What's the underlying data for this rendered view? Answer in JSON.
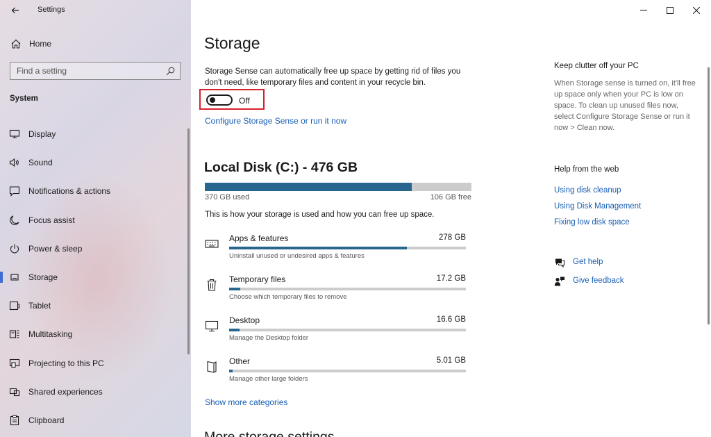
{
  "window": {
    "title": "Settings",
    "controls": {
      "minimize": "minimize",
      "maximize": "maximize",
      "close": "close"
    }
  },
  "sidebar": {
    "home_label": "Home",
    "search_placeholder": "Find a setting",
    "section_label": "System",
    "items": [
      {
        "label": "Display",
        "icon": "display-icon"
      },
      {
        "label": "Sound",
        "icon": "sound-icon"
      },
      {
        "label": "Notifications & actions",
        "icon": "notifications-icon"
      },
      {
        "label": "Focus assist",
        "icon": "moon-icon"
      },
      {
        "label": "Power & sleep",
        "icon": "power-icon"
      },
      {
        "label": "Storage",
        "icon": "storage-icon",
        "selected": true
      },
      {
        "label": "Tablet",
        "icon": "tablet-icon"
      },
      {
        "label": "Multitasking",
        "icon": "multitasking-icon"
      },
      {
        "label": "Projecting to this PC",
        "icon": "projecting-icon"
      },
      {
        "label": "Shared experiences",
        "icon": "shared-icon"
      },
      {
        "label": "Clipboard",
        "icon": "clipboard-icon"
      }
    ]
  },
  "main": {
    "title": "Storage",
    "storage_sense": {
      "description": "Storage Sense can automatically free up space by getting rid of files you don't need, like temporary files and content in your recycle bin.",
      "toggle_state": "Off",
      "toggle_on": false,
      "configure_link": "Configure Storage Sense or run it now"
    },
    "disk": {
      "title": "Local Disk (C:) - 476 GB",
      "used_label": "370 GB used",
      "free_label": "106 GB free",
      "used_fraction": 0.777,
      "description": "This is how your storage is used and how you can free up space."
    },
    "categories": [
      {
        "name": "Apps & features",
        "size": "278 GB",
        "subtitle": "Uninstall unused or undesired apps & features",
        "fraction": 0.751,
        "icon": "keyboard-icon"
      },
      {
        "name": "Temporary files",
        "size": "17.2 GB",
        "subtitle": "Choose which temporary files to remove",
        "fraction": 0.046,
        "icon": "trash-icon"
      },
      {
        "name": "Desktop",
        "size": "16.6 GB",
        "subtitle": "Manage the Desktop folder",
        "fraction": 0.045,
        "icon": "monitor-icon"
      },
      {
        "name": "Other",
        "size": "5.01 GB",
        "subtitle": "Manage other large folders",
        "fraction": 0.014,
        "icon": "book-icon"
      }
    ],
    "show_more": "Show more categories",
    "next_heading_partial": "More storage settings"
  },
  "right": {
    "clutter_heading": "Keep clutter off your PC",
    "clutter_text": "When Storage sense is turned on, it'll free up space only when your PC is low on space. To clean up unused files now, select Configure Storage Sense or run it now > Clean now.",
    "web_heading": "Help from the web",
    "web_links": [
      "Using disk cleanup",
      "Using Disk Management",
      "Fixing low disk space"
    ],
    "get_help": "Get help",
    "give_feedback": "Give feedback"
  },
  "colors": {
    "accent": "#27678f",
    "link": "#1a5fb4",
    "highlight_box": "#d6202c",
    "selected_marker": "#3f6ed1",
    "bar_background": "#cccccc"
  }
}
